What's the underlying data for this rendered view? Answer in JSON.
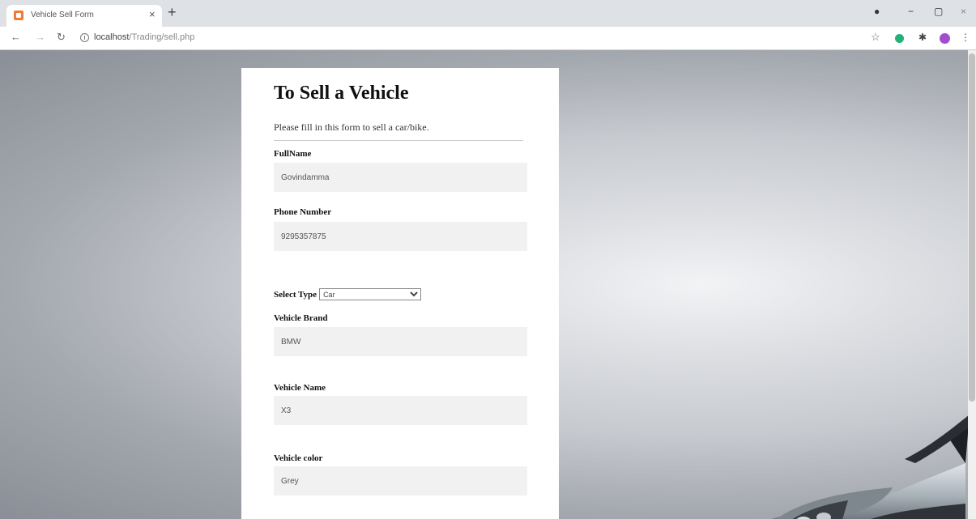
{
  "browser": {
    "tab_title": "Vehicle Sell Form",
    "url_host": "localhost",
    "url_path": "/Trading/sell.php",
    "colors": {
      "favicon": "#ee7c3b",
      "ext_green": "#26b07a",
      "profile": "#a24dd0"
    }
  },
  "form": {
    "title": "To Sell a Vehicle",
    "subtitle": "Please fill in this form to sell a car/bike.",
    "fields": [
      {
        "label": "FullName",
        "value": "Govindamma"
      },
      {
        "label": "Phone Number",
        "value": "9295357875"
      }
    ],
    "select_type": {
      "label": "Select Type",
      "value": "Car",
      "options": [
        "Car"
      ]
    },
    "vehicle_fields": [
      {
        "label": "Vehicle Brand",
        "value": "BMW"
      },
      {
        "label": "Vehicle Name",
        "value": "X3"
      },
      {
        "label": "Vehicle color",
        "value": "Grey"
      }
    ]
  }
}
